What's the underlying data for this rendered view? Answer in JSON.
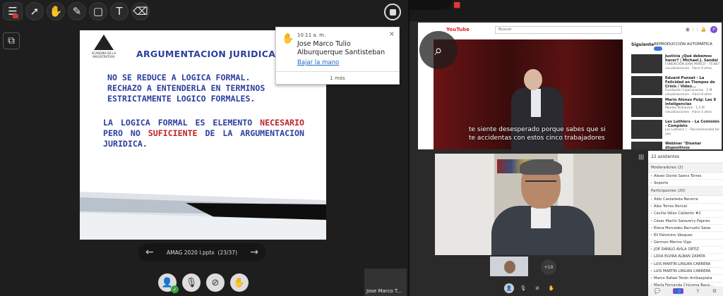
{
  "toolbar": {
    "tools": [
      "menu-icon",
      "pointer-icon",
      "hand-icon",
      "pen-icon",
      "rectangle-icon",
      "text-icon",
      "eraser-icon"
    ]
  },
  "slide": {
    "logo_text": "ACADEMIA DE LA MAGISTRATURA",
    "title": "ARGUMENTACION JURIDICA",
    "bullet1": "NO SE REDUCE A LOGICA FORMAL.",
    "bullet2": "RECHAZO A ENTENDERLA EN TERMINOS ESTRICTAMENTE LOGICO FORMALES.",
    "para_a": "LA LOGICA FORMAL ES ELEMENTO",
    "para_red1": "NECESARIO",
    "para_b": " PERO NO ",
    "para_red2": "SUFICIENTE",
    "para_c": " DE LA ARGUMENTACION JURIDICA."
  },
  "notification": {
    "time": "10:11 a. m.",
    "name": "Jose Marco Tulio Alburquerque Santisteban",
    "action": "Bajar la mano",
    "more": "1 más",
    "close": "×"
  },
  "navigation": {
    "prev": "←",
    "file": "AMAG 2020 I.pptx",
    "page": "(23/37)",
    "next": "→"
  },
  "self_tile": {
    "label": "Jose Marco T..."
  },
  "youtube": {
    "logo": "YouTube",
    "search_placeholder": "Buscar",
    "sidebar_title": "Siguiente",
    "autoplay": "REPRODUCCIÓN AUTOMÁTICA",
    "avatar_letter": "P",
    "subtitle_line1": "te siente desesperado porque sabes que si",
    "subtitle_line2": "te accidentas con estos cinco trabajadores",
    "suggestions": [
      {
        "title": "Justicia ¿Qué debemos hacer? | Michael J. Sandel",
        "meta": "FUNDACIÓN JUAN MARCH · 70.867 visualizaciones · Hace 9 años"
      },
      {
        "title": "Eduard Punset - La Felicidad en Tiempos de Crisis / Video...",
        "meta": "Fundación CajaCanarias · 1 M visualizaciones · Hace 8 años"
      },
      {
        "title": "Mario Alonso Puig: Las 9 inteligencias",
        "meta": "Mentes Brillantes · 1,5 M visualizaciones · Hace 3 años"
      },
      {
        "title": "Les Luthiers - La Comisión - Completo",
        "meta": "Les Luthiers ♪ · Recommended for you"
      },
      {
        "title": "Webinar \"Diseñar dispositivos",
        "meta": ""
      }
    ]
  },
  "participants": {
    "count": "22 asistentes",
    "moderators_label": "Moderadores (2)",
    "moderators": [
      "Alexei Dante Saenz Torres",
      "Soporte"
    ],
    "participants_label": "Participantes (20)",
    "list": [
      "Aldo Castañeda Becerra",
      "Alex Torres Roncal",
      "Cecilia Vélez Calderón #2",
      "César Martín Salaverry Pajares",
      "Elena Mercedes Barrueto Salas",
      "Eli Palomino Vásquez",
      "German Merino Vigo",
      "JOE DANILO AVILA ORTIZ",
      "LIDIA ELVIRA ALBAN ZAPATA",
      "LUIS MARTIN LINGAN CABRERA",
      "LUIS MARTIN LINGAN CABRERA",
      "Marco Rafael Terán Arribasplata",
      "María Fernanda Chicoma Baca..."
    ]
  },
  "video_tiles": {
    "plus_count": "+19"
  }
}
